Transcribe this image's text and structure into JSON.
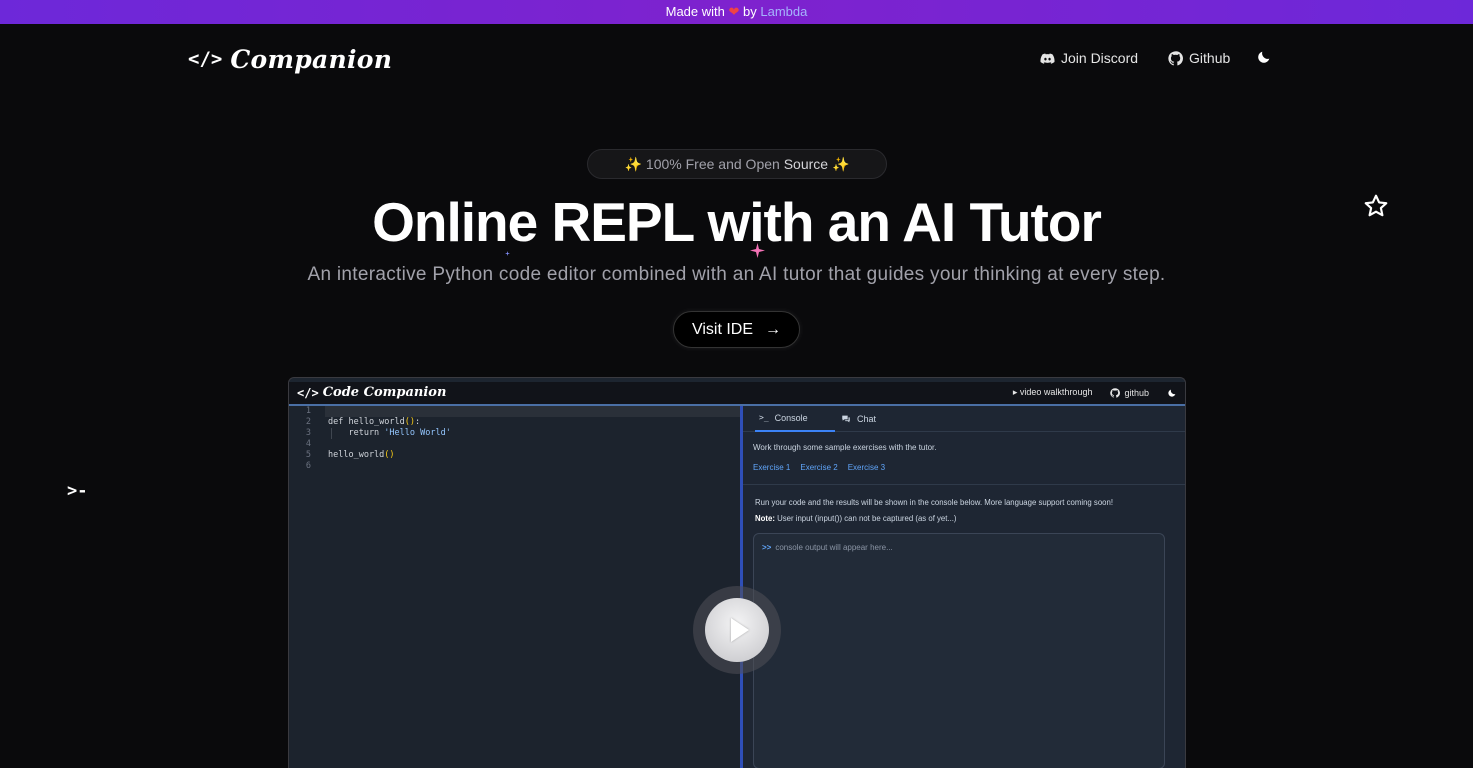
{
  "banner": {
    "prefix": "Made with",
    "heart": "❤",
    "by": "by",
    "lambda": "Lambda"
  },
  "nav": {
    "brand_icon": "</>",
    "brand": "Companion",
    "discord": "Join Discord",
    "github": "Github",
    "theme_icon": "moon-icon"
  },
  "hero": {
    "badge_pre": "✨ 100% Free and Open",
    "badge_bold": "Source",
    "badge_post": "✨",
    "title": "Online REPL with an AI Tutor",
    "subtitle": "An interactive Python code editor combined with an AI tutor that guides your thinking at every step.",
    "cta_label": "Visit IDE",
    "cta_arrow": "→"
  },
  "decor": {
    "prompt": ">-"
  },
  "preview": {
    "brand_icon": "</>",
    "brand": "Code Companion",
    "walkthrough": "▸ video walkthrough",
    "github": "github",
    "editor": {
      "lines": [
        {
          "n": "1",
          "code": ""
        },
        {
          "n": "2",
          "code": "def hello_world():"
        },
        {
          "n": "3",
          "code": "    return 'Hello World'"
        },
        {
          "n": "4",
          "code": ""
        },
        {
          "n": "5",
          "code": "hello_world()"
        },
        {
          "n": "6",
          "code": ""
        }
      ]
    },
    "tabs": {
      "console": "Console",
      "chat": "Chat"
    },
    "intro": "Work through some sample exercises with the tutor.",
    "exercises": [
      "Exercise 1",
      "Exercise 2",
      "Exercise 3"
    ],
    "run_note": "Run your code and the results will be shown in the console below. More language support coming soon!",
    "note_label": "Note:",
    "note_text": "User input (input()) can not be captured (as of yet...)",
    "console_prompt": ">>",
    "console_placeholder": "console output will appear here..."
  }
}
